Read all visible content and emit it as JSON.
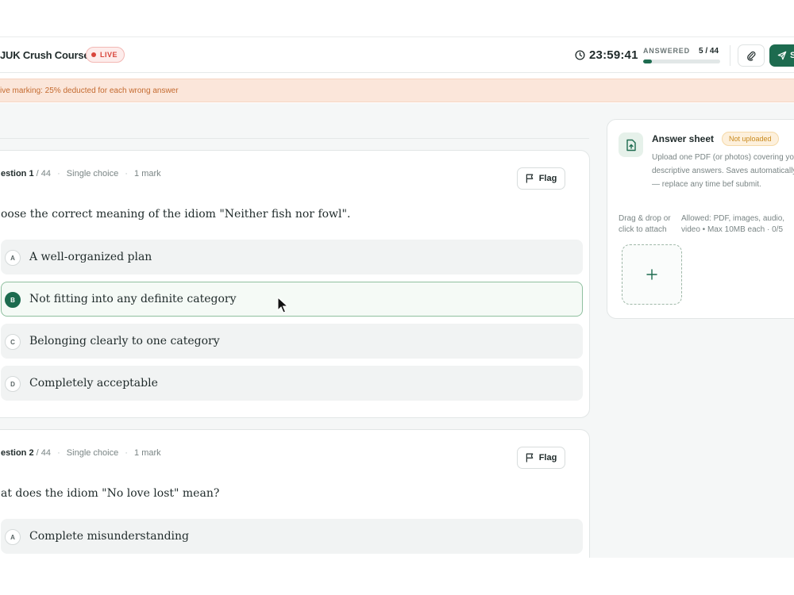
{
  "header": {
    "course_title": "JUK Crush Course",
    "live_label": "LIVE",
    "timer": "23:59:41",
    "answered_label": "ANSWERED",
    "answered_count": "5 / 44",
    "answered_fraction": 0.11,
    "submit_label": "S"
  },
  "banner": {
    "text": "ive marking: 25% deducted for each wrong answer"
  },
  "questions": [
    {
      "number": "estion 1",
      "total": "/ 44",
      "type": "Single choice",
      "marks": "1 mark",
      "flag_label": "Flag",
      "text": "oose the correct meaning of the idiom \"Neither fish nor fowl\".",
      "options": [
        {
          "letter": "A",
          "text": "A well-organized plan",
          "selected": false
        },
        {
          "letter": "B",
          "text": "Not fitting into any definite category",
          "selected": true
        },
        {
          "letter": "C",
          "text": "Belonging clearly to one category",
          "selected": false
        },
        {
          "letter": "D",
          "text": "Completely acceptable",
          "selected": false
        }
      ]
    },
    {
      "number": "estion 2",
      "total": "/ 44",
      "type": "Single choice",
      "marks": "1 mark",
      "flag_label": "Flag",
      "text": "at does the idiom \"No love lost\" mean?",
      "options": [
        {
          "letter": "A",
          "text": "Complete misunderstanding",
          "selected": false
        }
      ]
    }
  ],
  "answer_sheet": {
    "title": "Answer sheet",
    "status": "Not uploaded",
    "description": "Upload one PDF (or photos) covering your descriptive answers. Saves automatically — replace any time bef submit.",
    "drag_hint": "Drag & drop or click to attach",
    "allowed": "Allowed: PDF, images, audio, video • Max 10MB each · 0/5"
  },
  "colors": {
    "accent": "#1d6b4f",
    "live_red": "#d8453b",
    "warning_bg": "#fbe6da",
    "warning_text": "#c46a2f"
  }
}
